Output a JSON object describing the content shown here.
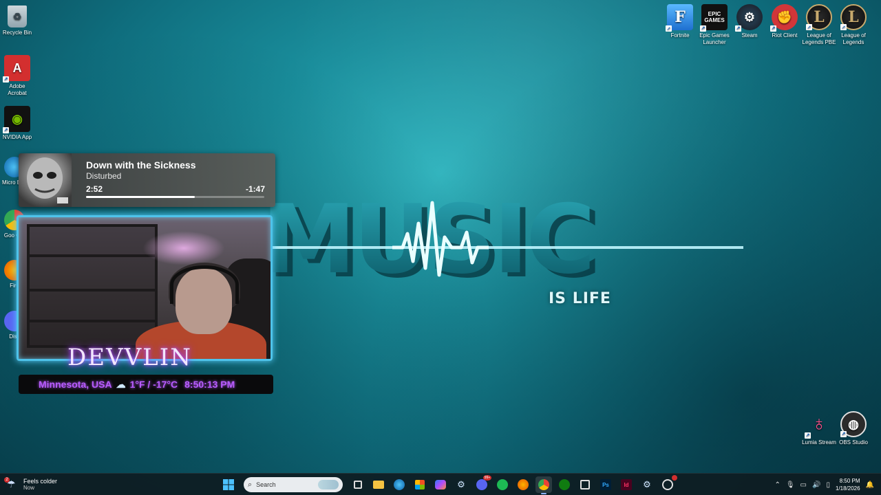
{
  "wallpaper": {
    "word": "MUSIC",
    "tagline": "IS LIFE"
  },
  "desktop_left": [
    {
      "label": "Recycle Bin",
      "icon": "recycle-bin-icon"
    },
    {
      "label": "Adobe Acrobat",
      "icon": "adobe-acrobat-icon"
    },
    {
      "label": "NVIDIA App",
      "icon": "nvidia-icon"
    },
    {
      "label": "Micro Edg",
      "icon": "edge-icon"
    },
    {
      "label": "Goo Chr",
      "icon": "chrome-icon"
    },
    {
      "label": "Fire",
      "icon": "firefox-icon"
    },
    {
      "label": "Disc",
      "icon": "discord-icon"
    }
  ],
  "desktop_top_right": [
    {
      "label": "Fortnite",
      "icon": "fortnite-icon"
    },
    {
      "label": "Epic Games Launcher",
      "icon": "epic-games-icon",
      "glyph": "EPIC\nGAMES"
    },
    {
      "label": "Steam",
      "icon": "steam-icon"
    },
    {
      "label": "Riot Client",
      "icon": "riot-client-icon"
    },
    {
      "label": "League of Legends PBE",
      "icon": "league-pbe-icon"
    },
    {
      "label": "League of Legends",
      "icon": "league-icon"
    }
  ],
  "desktop_bottom_right": [
    {
      "label": "Lumia Stream",
      "icon": "lumia-stream-icon"
    },
    {
      "label": "OBS Studio",
      "icon": "obs-studio-icon"
    }
  ],
  "media": {
    "title": "Down with the Sickness",
    "artist": "Disturbed",
    "elapsed": "2:52",
    "remaining": "-1:47",
    "progress": 0.61
  },
  "overlay": {
    "name": "DEVVLIN",
    "location": "Minnesota, USA",
    "temperature": "1°F / -17°C",
    "time": "8:50:13 PM"
  },
  "taskbar": {
    "weather_title": "Feels colder",
    "weather_sub": "Now",
    "weather_badge": "2",
    "search_placeholder": "Search",
    "apps": [
      {
        "name": "task-view-icon"
      },
      {
        "name": "file-explorer-icon"
      },
      {
        "name": "edge-icon"
      },
      {
        "name": "microsoft-store-icon"
      },
      {
        "name": "copilot-icon"
      },
      {
        "name": "steam-icon"
      },
      {
        "name": "discord-icon",
        "badge": "99+"
      },
      {
        "name": "spotify-icon"
      },
      {
        "name": "firefox-icon"
      },
      {
        "name": "chrome-icon",
        "active": true
      },
      {
        "name": "xbox-icon"
      },
      {
        "name": "snipping-tool-icon"
      },
      {
        "name": "photoshop-icon",
        "glyph": "Ps"
      },
      {
        "name": "indesign-icon",
        "glyph": "Id"
      },
      {
        "name": "steam-icon-2"
      },
      {
        "name": "obs-icon"
      }
    ],
    "time": "8:50 PM",
    "date": "1/18/2026"
  }
}
